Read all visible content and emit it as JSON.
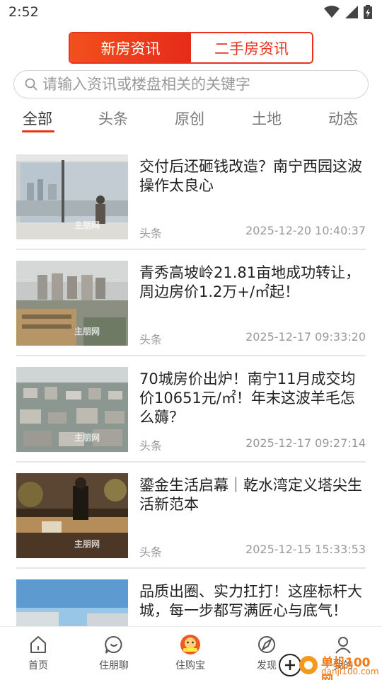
{
  "status_bar": {
    "time": "2:52",
    "icons": [
      "wifi-icon",
      "signal-icon",
      "battery-icon"
    ]
  },
  "segment": {
    "tabs": [
      "新房资讯",
      "二手房资讯"
    ],
    "active": "新房资讯"
  },
  "search": {
    "placeholder": "请输入资讯或楼盘相关的关键字",
    "value": ""
  },
  "categories": [
    {
      "label": "全部",
      "active": true
    },
    {
      "label": "头条"
    },
    {
      "label": "原创"
    },
    {
      "label": "土地"
    },
    {
      "label": "动态"
    }
  ],
  "articles": [
    {
      "title": "交付后还砸钱改造？南宁西园这波操作太良心",
      "tag": "头条",
      "date": "2025-12-20 10:40:37",
      "watermark": "主朋网"
    },
    {
      "title": "青秀高坡岭21.81亩地成功转让，周边房价1.2万+/㎡起！",
      "tag": "头条",
      "date": "2025-12-17 09:33:20",
      "watermark": "主朋网"
    },
    {
      "title": "70城房价出炉！南宁11月成交均价10651元/㎡！年末这波羊毛怎么薅？",
      "tag": "头条",
      "date": "2025-12-17 09:27:14",
      "watermark": "主朋网"
    },
    {
      "title": "鎏金生活启幕｜乾水湾定义塔尖生活新范本",
      "tag": "头条",
      "date": "2025-12-15 15:33:53",
      "watermark": "主朋网"
    },
    {
      "title": "品质出圈、实力扛打！这座标杆大城，每一步都写满匠心与底气！",
      "tag": "",
      "date": "",
      "watermark": ""
    }
  ],
  "bottom_nav": [
    {
      "label": "首页",
      "icon": "home-icon"
    },
    {
      "label": "住朋聊",
      "icon": "chat-icon"
    },
    {
      "label": "住购宝",
      "icon": "mascot-icon"
    },
    {
      "label": "发现",
      "icon": "compass-icon"
    },
    {
      "label": "我的",
      "icon": "profile-icon"
    }
  ],
  "overlay_logo": {
    "name": "单机100网",
    "url": "danji100.com"
  },
  "colors": {
    "accent": "#e8341c",
    "text": "#222222",
    "muted": "#999999"
  }
}
